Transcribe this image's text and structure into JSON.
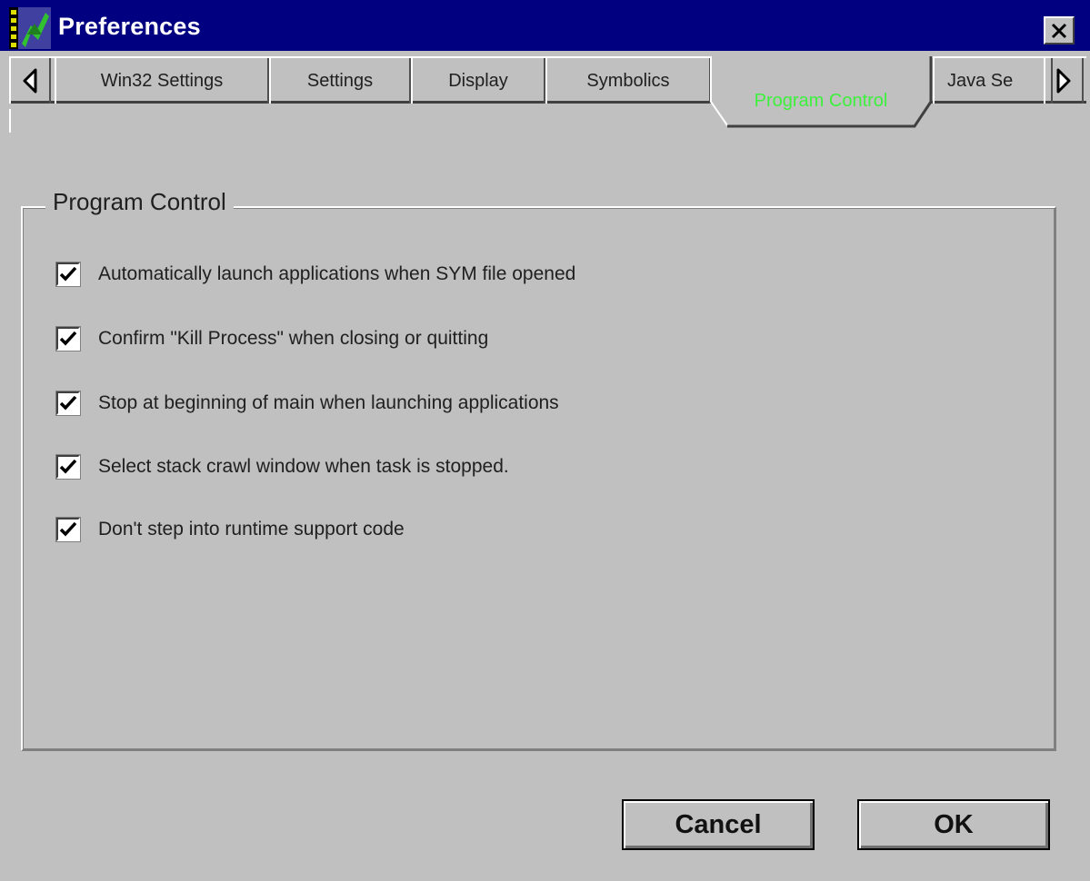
{
  "window": {
    "title": "Preferences"
  },
  "tabs": {
    "items": [
      {
        "label": "Win32 Settings"
      },
      {
        "label": "Settings"
      },
      {
        "label": "Display"
      },
      {
        "label": "Symbolics"
      },
      {
        "label": "Program Control"
      },
      {
        "label": "Java Se"
      }
    ],
    "active": "Program Control"
  },
  "group": {
    "title": "Program Control",
    "options": [
      {
        "label": "Automatically launch applications when SYM file opened",
        "checked": true
      },
      {
        "label": "Confirm \"Kill Process\" when closing or quitting",
        "checked": true
      },
      {
        "label": "Stop at beginning of main when launching applications",
        "checked": true
      },
      {
        "label": "Select stack crawl window when task is stopped.",
        "checked": true
      },
      {
        "label": "Don't step into runtime support code",
        "checked": true
      }
    ]
  },
  "buttons": {
    "cancel": "Cancel",
    "ok": "OK"
  },
  "colors": {
    "titlebar": "#000080",
    "active_tab_text": "#3cf03c",
    "face": "#c0c0c0"
  }
}
